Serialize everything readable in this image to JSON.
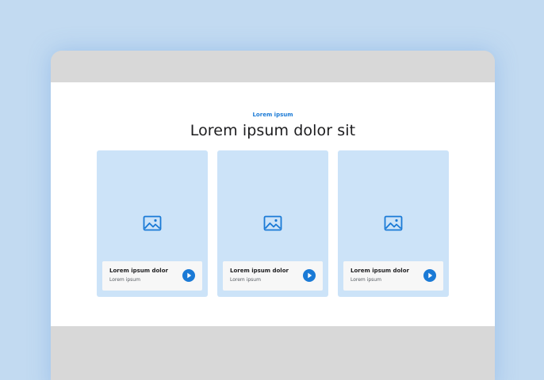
{
  "section": {
    "eyebrow": "Lorem ipsum",
    "heading": "Lorem ipsum dolor sit"
  },
  "cards": [
    {
      "image_icon": "image-icon",
      "title": "Lorem ipsum dolor",
      "subtitle": "Lorem ipsum",
      "action_icon": "play-icon"
    },
    {
      "image_icon": "image-icon",
      "title": "Lorem ipsum dolor",
      "subtitle": "Lorem ipsum",
      "action_icon": "play-icon"
    },
    {
      "image_icon": "image-icon",
      "title": "Lorem ipsum dolor",
      "subtitle": "Lorem ipsum",
      "action_icon": "play-icon"
    }
  ],
  "colors": {
    "background": "#c2daf1",
    "accent": "#1a7ad6",
    "card": "#cce3f8",
    "chrome": "#d8d8d8"
  }
}
